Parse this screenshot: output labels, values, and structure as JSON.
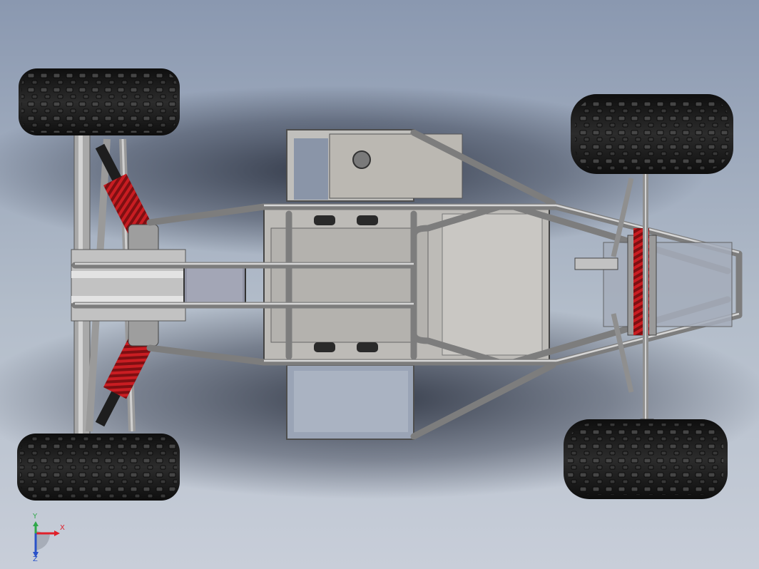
{
  "viewport": {
    "background_top": "#8a98b0",
    "background_bottom": "#c4cad6",
    "shadow_color": "#1f2533"
  },
  "colors": {
    "tire": "#1b1b1b",
    "tread": "#3a3a3a",
    "tube": "#8d8d8d",
    "tube_light": "#c9c9c9",
    "panel": "#b8b6b2",
    "spring": "#b3171c",
    "seat": "#8f93a3",
    "axis_x": "#e0202a",
    "axis_y": "#2fa84a",
    "axis_z": "#2a52c9"
  },
  "triad": {
    "x_label": "X",
    "y_label": "Y",
    "z_label": "Z"
  },
  "icons": [
    "view-orientation-triad-icon"
  ]
}
